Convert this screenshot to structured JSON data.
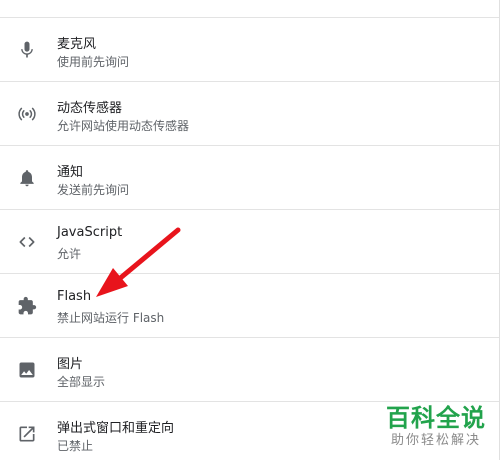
{
  "settings": {
    "items": [
      {
        "icon": "microphone-icon",
        "title": "麦克风",
        "subtitle": "使用前先询问"
      },
      {
        "icon": "motion-sensor-icon",
        "title": "动态传感器",
        "subtitle": "允许网站使用动态传感器"
      },
      {
        "icon": "bell-icon",
        "title": "通知",
        "subtitle": "发送前先询问"
      },
      {
        "icon": "code-icon",
        "title": "JavaScript",
        "subtitle": "允许"
      },
      {
        "icon": "puzzle-icon",
        "title": "Flash",
        "subtitle": "禁止网站运行 Flash"
      },
      {
        "icon": "image-icon",
        "title": "图片",
        "subtitle": "全部显示"
      },
      {
        "icon": "open-in-new-icon",
        "title": "弹出式窗口和重定向",
        "subtitle": "已禁止"
      }
    ]
  },
  "annotation": {
    "arrow_color": "#e8141c"
  },
  "watermark": {
    "main": "百科全说",
    "sub": "助你轻松解决",
    "color": "#22a34c"
  }
}
